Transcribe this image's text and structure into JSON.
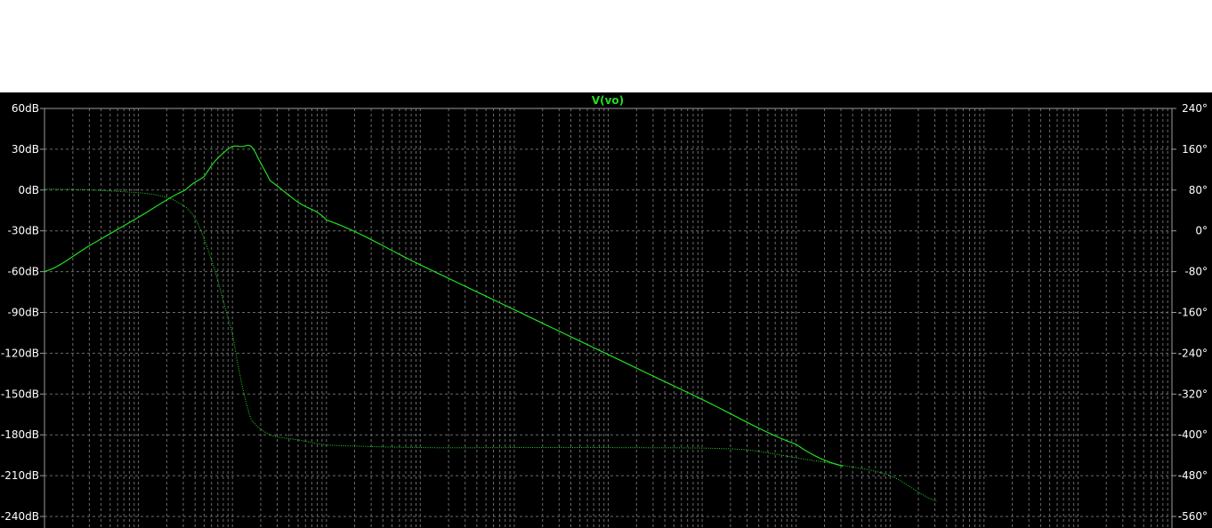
{
  "colors": {
    "background": "#000000",
    "grid": "#6b6b6b",
    "axis": "#9a9a9a",
    "text": "#ffffff",
    "trace": "#22dd22"
  },
  "chart_data": {
    "type": "line",
    "title": "V(vo)",
    "grid": true,
    "x_scale": "log",
    "x_decades_visible": 12,
    "left_axis": {
      "unit": "dB",
      "ylim": [
        -255,
        60
      ],
      "ticks": [
        "60dB",
        "30dB",
        "0dB",
        "-30dB",
        "-60dB",
        "-90dB",
        "-120dB",
        "-150dB",
        "-180dB",
        "-210dB",
        "-240dB"
      ],
      "tick_values": [
        60,
        30,
        0,
        -30,
        -60,
        -90,
        -120,
        -150,
        -180,
        -210,
        -240
      ]
    },
    "right_axis": {
      "unit": "deg",
      "ylim": [
        -600,
        240
      ],
      "ticks": [
        "240°",
        "160°",
        "80°",
        "0°",
        "-80°",
        "-160°",
        "-240°",
        "-320°",
        "-400°",
        "-480°",
        "-560°"
      ],
      "tick_values": [
        240,
        160,
        80,
        0,
        -80,
        -160,
        -240,
        -320,
        -400,
        -480,
        -560
      ]
    },
    "series": [
      {
        "style": "solid",
        "axis": "left",
        "x_decade": [
          0,
          0.5,
          1.0,
          1.5,
          1.7,
          1.8,
          1.9,
          2.0,
          2.1,
          2.2,
          2.3,
          2.4,
          2.7,
          3.0,
          4.0,
          5.0,
          6.0,
          7.0,
          8.0,
          8.5
        ],
        "values": [
          -60,
          -40,
          -20,
          0,
          10,
          20,
          27,
          32,
          32,
          32,
          20,
          7,
          -9,
          -22,
          -55,
          -88,
          -121,
          -154,
          -187,
          -203
        ]
      },
      {
        "style": "dotted",
        "axis": "right",
        "x_decade": [
          0,
          0.5,
          1.0,
          1.2,
          1.4,
          1.6,
          1.8,
          2.0,
          2.1,
          2.2,
          2.4,
          2.7,
          3.0,
          4.0,
          5.0,
          6.0,
          7.0,
          7.5,
          8.0,
          8.5,
          9.0,
          9.5
        ],
        "values": [
          82,
          80,
          75,
          70,
          58,
          25,
          -70,
          -200,
          -300,
          -370,
          -400,
          -410,
          -420,
          -425,
          -425,
          -425,
          -426,
          -430,
          -445,
          -460,
          -480,
          -530
        ]
      }
    ]
  }
}
